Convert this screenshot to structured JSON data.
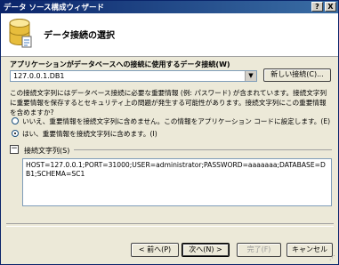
{
  "window": {
    "title": "データ ソース構成ウィザード",
    "help_btn": "?",
    "close_btn": "X"
  },
  "header": {
    "title": "データ接続の選択",
    "icon": "database-icon"
  },
  "connection": {
    "label": "アプリケーションがデータベースへの接続に使用するデータ接続(W)",
    "selected": "127.0.0.1.DB1",
    "new_connection_label": "新しい接続(C)..."
  },
  "info_text": "この接続文字列にはデータベース接続に必要な重要情報 (例: パスワード) が含まれています。接続文字列に重要情報を保存するとセキュリティ上の問題が発生する可能性があります。接続文字列にこの重要情報を含めますか?",
  "options": {
    "no_label": "いいえ、重要情報を接続文字列に含めません。この情報をアプリケーション コードに設定します。(E)",
    "yes_label": "はい、重要情報を接続文字列に含めます。(I)",
    "selected": "yes"
  },
  "connection_string": {
    "label": "接続文字列(S)",
    "value": "HOST=127.0.0.1;PORT=31000;USER=administrator;PASSWORD=aaaaaaa;DATABASE=DB1;SCHEMA=SC1"
  },
  "buttons": {
    "back": "< 前へ(P)",
    "next": "次へ(N) >",
    "finish": "完了(F)",
    "cancel": "キャンセル"
  }
}
